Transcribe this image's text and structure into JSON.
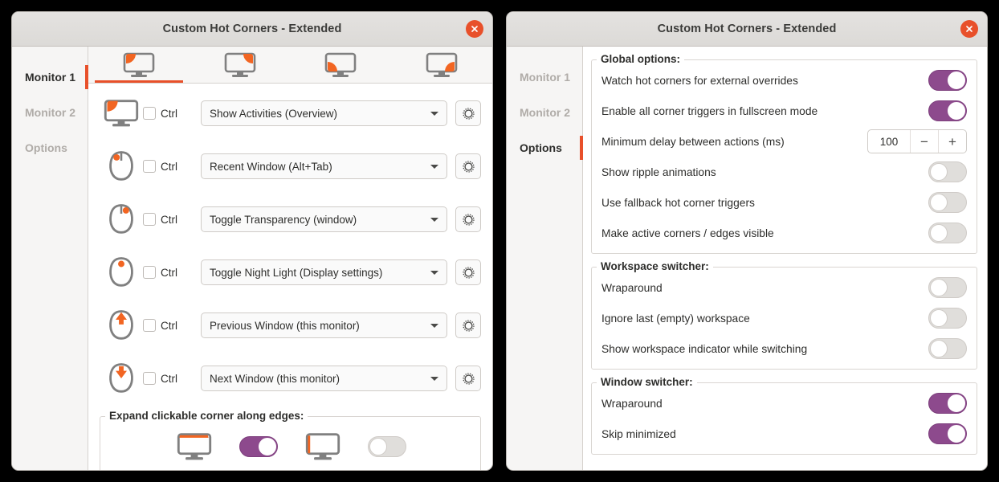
{
  "accent": {
    "orange": "#e8502a",
    "purple": "#8d4a8d",
    "icon_gray": "#808080",
    "muted_text": "#b0aca8"
  },
  "left_window": {
    "title": "Custom Hot Corners - Extended",
    "close_icon": "close-icon",
    "sidebar": {
      "items": [
        {
          "label": "Monitor 1",
          "active": true
        },
        {
          "label": "Monitor 2",
          "active": false
        },
        {
          "label": "Options",
          "active": false
        }
      ]
    },
    "tabs": [
      {
        "icon": "monitor-corner-top-left-icon",
        "active": true
      },
      {
        "icon": "monitor-corner-top-right-icon",
        "active": false
      },
      {
        "icon": "monitor-corner-bottom-left-icon",
        "active": false
      },
      {
        "icon": "monitor-corner-bottom-right-icon",
        "active": false
      }
    ],
    "corner_rows": [
      {
        "icon": "monitor-corner-top-left-icon",
        "ctrl_label": "Ctrl",
        "ctrl_checked": false,
        "action": "Show Activities (Overview)",
        "settings_icon": "gear-icon"
      },
      {
        "icon": "mouse-click-left-icon",
        "ctrl_label": "Ctrl",
        "ctrl_checked": false,
        "action": "Recent Window (Alt+Tab)",
        "settings_icon": "gear-icon"
      },
      {
        "icon": "mouse-click-right-icon",
        "ctrl_label": "Ctrl",
        "ctrl_checked": false,
        "action": "Toggle Transparency (window)",
        "settings_icon": "gear-icon"
      },
      {
        "icon": "mouse-click-middle-icon",
        "ctrl_label": "Ctrl",
        "ctrl_checked": false,
        "action": "Toggle Night Light (Display settings)",
        "settings_icon": "gear-icon"
      },
      {
        "icon": "mouse-scroll-up-icon",
        "ctrl_label": "Ctrl",
        "ctrl_checked": false,
        "action": "Previous Window (this monitor)",
        "settings_icon": "gear-icon"
      },
      {
        "icon": "mouse-scroll-down-icon",
        "ctrl_label": "Ctrl",
        "ctrl_checked": false,
        "action": "Next Window (this monitor)",
        "settings_icon": "gear-icon"
      }
    ],
    "expand_section": {
      "title": "Expand clickable corner along edges:",
      "horizontal": {
        "icon": "monitor-edge-top-icon",
        "enabled": true
      },
      "vertical": {
        "icon": "monitor-edge-left-icon",
        "enabled": false
      }
    }
  },
  "right_window": {
    "title": "Custom Hot Corners - Extended",
    "close_icon": "close-icon",
    "sidebar": {
      "items": [
        {
          "label": "Monitor 1",
          "active": false
        },
        {
          "label": "Monitor 2",
          "active": false
        },
        {
          "label": "Options",
          "active": true
        }
      ]
    },
    "groups": [
      {
        "title": "Global options:",
        "rows": [
          {
            "label": "Watch hot corners for external overrides",
            "control": "switch",
            "enabled": true
          },
          {
            "label": "Enable all corner triggers in fullscreen mode",
            "control": "switch",
            "enabled": true
          },
          {
            "label": "Minimum delay between actions (ms)",
            "control": "spin",
            "value": "100",
            "minus": "−",
            "plus": "+"
          },
          {
            "label": "Show ripple animations",
            "control": "switch",
            "enabled": false
          },
          {
            "label": "Use fallback hot corner triggers",
            "control": "switch",
            "enabled": false
          },
          {
            "label": "Make active corners / edges visible",
            "control": "switch",
            "enabled": false
          }
        ]
      },
      {
        "title": "Workspace switcher:",
        "rows": [
          {
            "label": "Wraparound",
            "control": "switch",
            "enabled": false
          },
          {
            "label": "Ignore last (empty) workspace",
            "control": "switch",
            "enabled": false
          },
          {
            "label": "Show workspace indicator while switching",
            "control": "switch",
            "enabled": false
          }
        ]
      },
      {
        "title": "Window switcher:",
        "rows": [
          {
            "label": "Wraparound",
            "control": "switch",
            "enabled": true
          },
          {
            "label": "Skip minimized",
            "control": "switch",
            "enabled": true
          }
        ]
      }
    ]
  }
}
